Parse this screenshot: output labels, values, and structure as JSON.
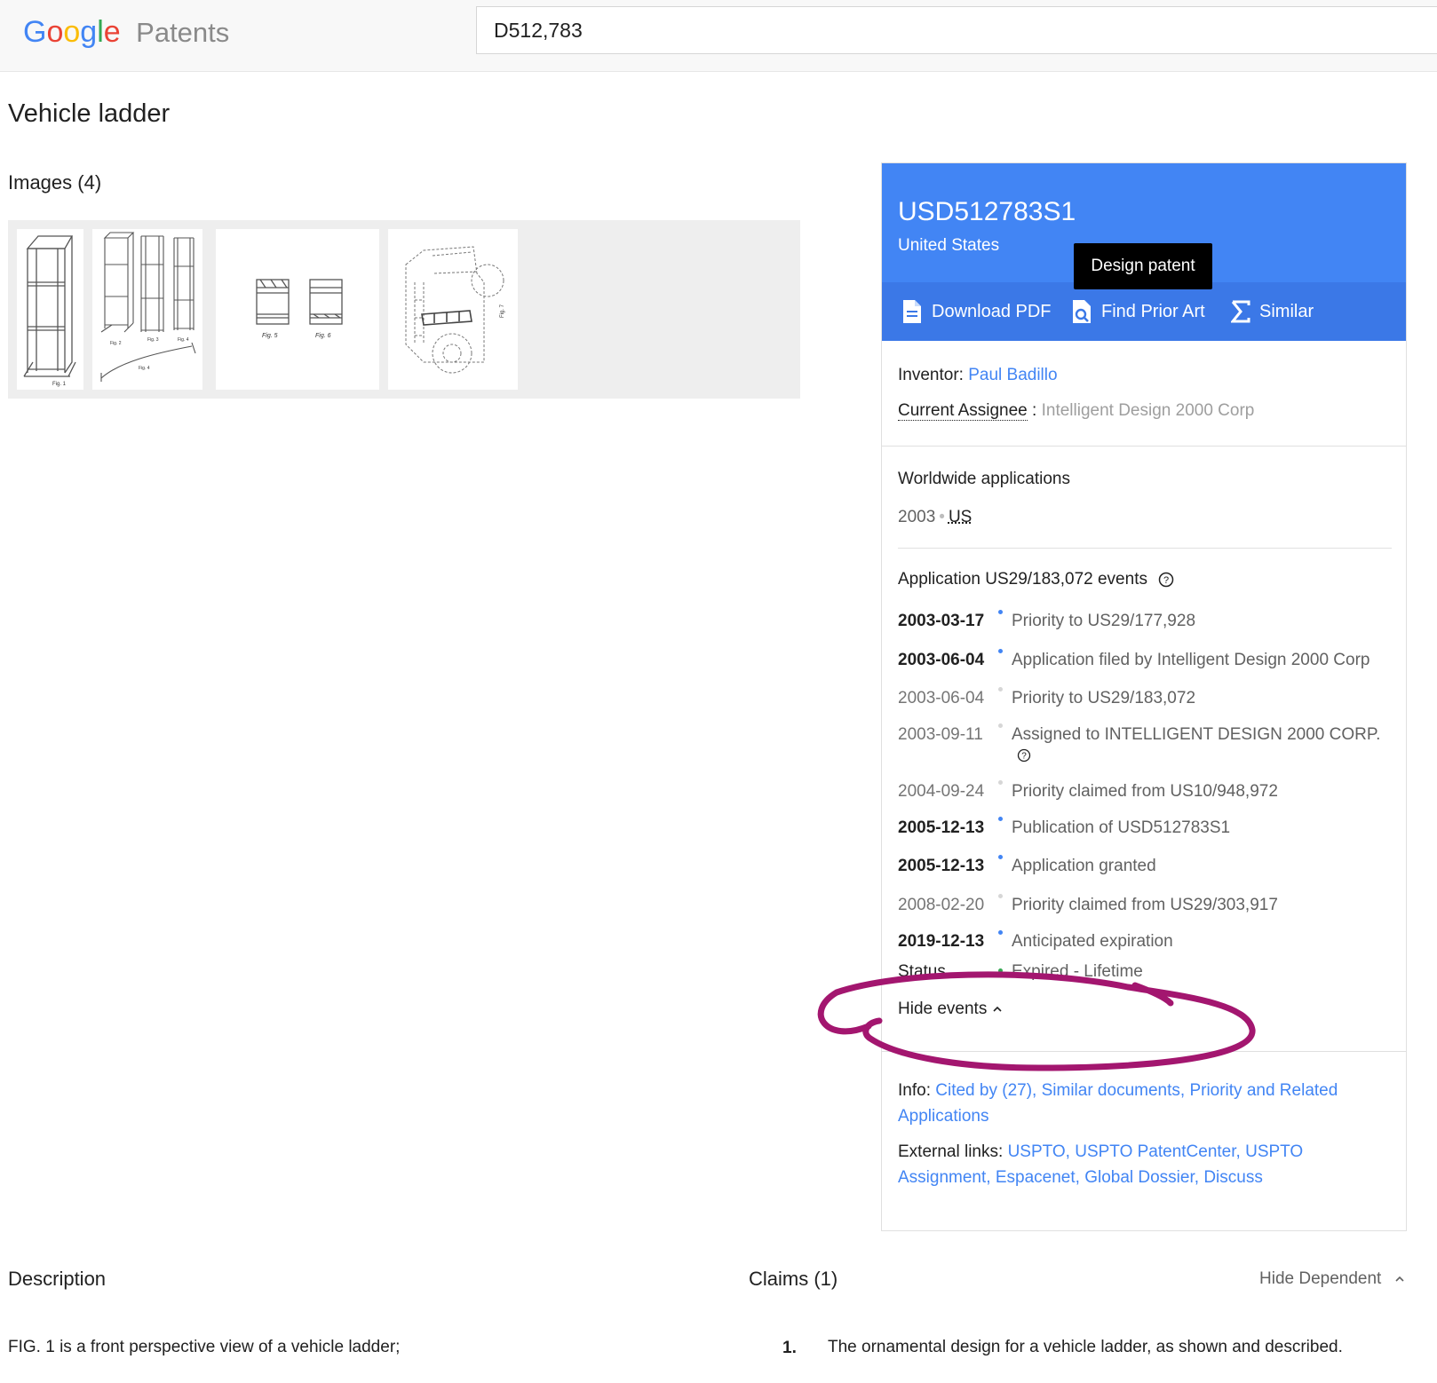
{
  "header": {
    "logo_letters": [
      "G",
      "o",
      "o",
      "g",
      "l",
      "e"
    ],
    "logo_colors": [
      "#4285f4",
      "#ea4335",
      "#fbbc05",
      "#4285f4",
      "#34a853",
      "#ea4335"
    ],
    "logo_suffix": "Patents",
    "search_value": "D512,783"
  },
  "page_title": "Vehicle ladder",
  "images": {
    "heading": "Images (4)",
    "thumb_labels": {
      "t1": "Fig. 1",
      "t2": [
        "Fig. 2",
        "Fig. 3",
        "Fig. 4"
      ],
      "t3": [
        "Fig. 5",
        "Fig. 6"
      ],
      "t4": "Fig. 7"
    }
  },
  "card": {
    "pub_number": "USD512783S1",
    "country": "United States",
    "tooltip": "Design patent",
    "actions": {
      "download": "Download PDF",
      "prior_art": "Find Prior Art",
      "similar": "Similar"
    },
    "inventor_label": "Inventor:",
    "inventor": "Paul Badillo",
    "assignee_label": "Current Assignee",
    "assignee_sep": " :",
    "assignee": "Intelligent Design 2000 Corp",
    "worldwide_heading": "Worldwide applications",
    "worldwide_year": "2003",
    "worldwide_country": "US",
    "events_heading": "Application US29/183,072 events",
    "events": [
      {
        "date": "2003-03-17",
        "text": "Priority to US29/177,928"
      },
      {
        "date": "2003-06-04",
        "text": "Application filed by Intelligent Design 2000 Corp"
      },
      {
        "date": "2003-06-04",
        "text": "Priority to US29/183,072"
      },
      {
        "date": "2003-09-11",
        "text": "Assigned to INTELLIGENT DESIGN 2000 CORP."
      },
      {
        "date": "2004-09-24",
        "text": "Priority claimed from US10/948,972"
      },
      {
        "date": "2005-12-13",
        "text": "Publication of USD512783S1"
      },
      {
        "date": "2005-12-13",
        "text": "Application granted"
      },
      {
        "date": "2008-02-20",
        "text": "Priority claimed from US29/303,917"
      },
      {
        "date": "2019-12-13",
        "text": "Anticipated expiration"
      }
    ],
    "status_label": "Status",
    "status_value": "Expired - Lifetime",
    "hide_events": "Hide events",
    "info_label": "Info:",
    "info_links": [
      "Cited by (27),",
      "Similar documents,",
      "Priority and Related Applications"
    ],
    "external_label": "External links:",
    "external_links": [
      "USPTO,",
      "USPTO PatentCenter,",
      "USPTO Assignment,",
      "Espacenet,",
      "Global Dossier,",
      "Discuss"
    ]
  },
  "description": {
    "heading": "Description",
    "first_line": "FIG. 1 is a front perspective view of a vehicle ladder;"
  },
  "claims": {
    "heading": "Claims (1)",
    "hide_dependent": "Hide Dependent",
    "claim_number": "1.",
    "claim_text": "The ornamental design for a vehicle ladder, as shown and described."
  },
  "annotation_color": "#a3166f"
}
